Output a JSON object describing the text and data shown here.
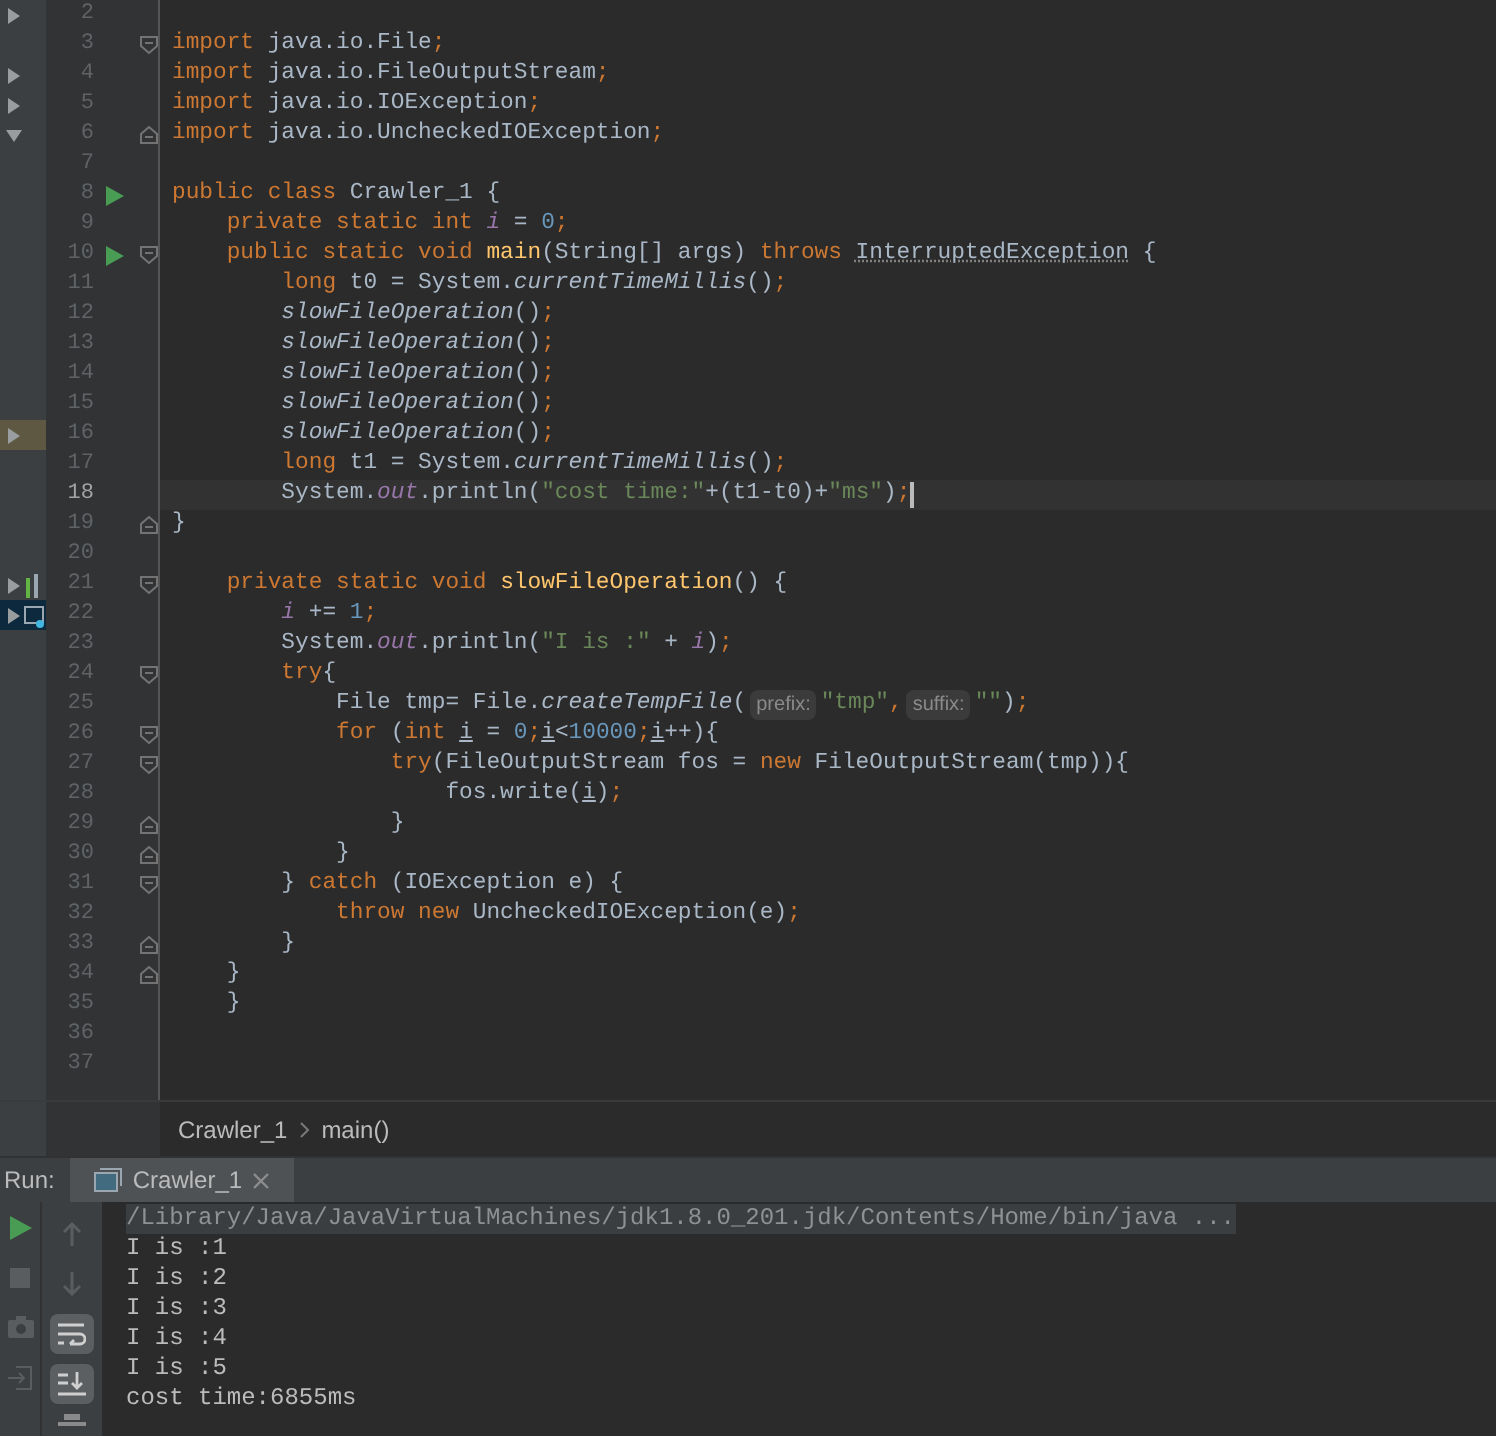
{
  "editor": {
    "lines": [
      {
        "number": "2",
        "fold_start": false,
        "fold_end": false,
        "run": false,
        "current": false,
        "tree": {
          "kind": "plain",
          "expanded": false,
          "highlighted": false,
          "selected": false
        }
      },
      {
        "number": "3",
        "fold_start": true,
        "fold_end": false,
        "run": false,
        "current": false,
        "tokens": [
          {
            "kind": "kw",
            "text": "import"
          },
          {
            "kind": "plain",
            "text": " java.io.File"
          },
          {
            "kind": "kw",
            "text": ";"
          }
        ]
      },
      {
        "number": "4",
        "fold_start": false,
        "fold_end": false,
        "run": false,
        "current": false,
        "tree": {
          "kind": "plain",
          "expanded": false,
          "highlighted": false,
          "selected": false
        },
        "tokens": [
          {
            "kind": "kw",
            "text": "import"
          },
          {
            "kind": "plain",
            "text": " java.io.FileOutputStream"
          },
          {
            "kind": "kw",
            "text": ";"
          }
        ]
      },
      {
        "number": "5",
        "fold_start": false,
        "fold_end": false,
        "run": false,
        "current": false,
        "tree": {
          "kind": "plain",
          "expanded": false,
          "highlighted": false,
          "selected": false
        },
        "tokens": [
          {
            "kind": "kw",
            "text": "import"
          },
          {
            "kind": "plain",
            "text": " java.io.IOException"
          },
          {
            "kind": "kw",
            "text": ";"
          }
        ]
      },
      {
        "number": "6",
        "fold_start": false,
        "fold_end": true,
        "run": false,
        "current": false,
        "tree": {
          "kind": "plain",
          "expanded": true,
          "highlighted": false,
          "selected": false
        },
        "tokens": [
          {
            "kind": "kw",
            "text": "import"
          },
          {
            "kind": "plain",
            "text": " java.io.UncheckedIOException"
          },
          {
            "kind": "kw",
            "text": ";"
          }
        ]
      },
      {
        "number": "7",
        "fold_start": false,
        "fold_end": false,
        "run": false,
        "current": false
      },
      {
        "number": "8",
        "fold_start": false,
        "fold_end": false,
        "run": true,
        "current": false,
        "tokens": [
          {
            "kind": "kw",
            "text": "public class "
          },
          {
            "kind": "plain",
            "text": "Crawler_1 {"
          }
        ]
      },
      {
        "number": "9",
        "fold_start": false,
        "fold_end": false,
        "run": false,
        "current": false,
        "tokens": [
          {
            "kind": "kw",
            "text": "    private static int "
          },
          {
            "kind": "field",
            "text": "i"
          },
          {
            "kind": "plain",
            "text": " = "
          },
          {
            "kind": "num",
            "text": "0"
          },
          {
            "kind": "kw",
            "text": ";"
          }
        ]
      },
      {
        "number": "10",
        "fold_start": true,
        "fold_end": false,
        "run": true,
        "current": false,
        "tokens": [
          {
            "kind": "kw",
            "text": "    public static void "
          },
          {
            "kind": "decl",
            "text": "main"
          },
          {
            "kind": "plain",
            "text": "(String[] args) "
          },
          {
            "kind": "kw",
            "text": "throws "
          },
          {
            "kind": "warn",
            "text": "InterruptedException"
          },
          {
            "kind": "plain",
            "text": " {"
          }
        ]
      },
      {
        "number": "11",
        "fold_start": false,
        "fold_end": false,
        "run": false,
        "current": false,
        "tokens": [
          {
            "kind": "kw",
            "text": "        long "
          },
          {
            "kind": "plain",
            "text": "t0 = System."
          },
          {
            "kind": "static",
            "text": "currentTimeMillis"
          },
          {
            "kind": "plain",
            "text": "()"
          },
          {
            "kind": "kw",
            "text": ";"
          }
        ]
      },
      {
        "number": "12",
        "fold_start": false,
        "fold_end": false,
        "run": false,
        "current": false,
        "tokens": [
          {
            "kind": "static",
            "text": "        slowFileOperation"
          },
          {
            "kind": "plain",
            "text": "()"
          },
          {
            "kind": "kw",
            "text": ";"
          }
        ]
      },
      {
        "number": "13",
        "fold_start": false,
        "fold_end": false,
        "run": false,
        "current": false,
        "tokens": [
          {
            "kind": "static",
            "text": "        slowFileOperation"
          },
          {
            "kind": "plain",
            "text": "()"
          },
          {
            "kind": "kw",
            "text": ";"
          }
        ]
      },
      {
        "number": "14",
        "fold_start": false,
        "fold_end": false,
        "run": false,
        "current": false,
        "tokens": [
          {
            "kind": "static",
            "text": "        slowFileOperation"
          },
          {
            "kind": "plain",
            "text": "()"
          },
          {
            "kind": "kw",
            "text": ";"
          }
        ]
      },
      {
        "number": "15",
        "fold_start": false,
        "fold_end": false,
        "run": false,
        "current": false,
        "tokens": [
          {
            "kind": "static",
            "text": "        slowFileOperation"
          },
          {
            "kind": "plain",
            "text": "()"
          },
          {
            "kind": "kw",
            "text": ";"
          }
        ]
      },
      {
        "number": "16",
        "fold_start": false,
        "fold_end": false,
        "run": false,
        "current": false,
        "tree": {
          "kind": "plain",
          "expanded": false,
          "highlighted": true,
          "selected": false
        },
        "tokens": [
          {
            "kind": "static",
            "text": "        slowFileOperation"
          },
          {
            "kind": "plain",
            "text": "()"
          },
          {
            "kind": "kw",
            "text": ";"
          }
        ]
      },
      {
        "number": "17",
        "fold_start": false,
        "fold_end": false,
        "run": false,
        "current": false,
        "tokens": [
          {
            "kind": "kw",
            "text": "        long "
          },
          {
            "kind": "plain",
            "text": "t1 = System."
          },
          {
            "kind": "static",
            "text": "currentTimeMillis"
          },
          {
            "kind": "plain",
            "text": "()"
          },
          {
            "kind": "kw",
            "text": ";"
          }
        ]
      },
      {
        "number": "18",
        "fold_start": false,
        "fold_end": false,
        "run": false,
        "current": true,
        "tokens": [
          {
            "kind": "plain",
            "text": "        System."
          },
          {
            "kind": "sfield",
            "text": "out"
          },
          {
            "kind": "plain",
            "text": ".println("
          },
          {
            "kind": "str",
            "text": "\"cost time:\""
          },
          {
            "kind": "plain",
            "text": "+(t1-t0)+"
          },
          {
            "kind": "str",
            "text": "\"ms\""
          },
          {
            "kind": "plain",
            "text": ")"
          },
          {
            "kind": "kw",
            "text": ";"
          }
        ]
      },
      {
        "number": "19",
        "fold_start": false,
        "fold_end": true,
        "run": false,
        "current": false,
        "tokens": [
          {
            "kind": "plain",
            "text": "}"
          }
        ]
      },
      {
        "number": "20",
        "fold_start": false,
        "fold_end": false,
        "run": false,
        "current": false
      },
      {
        "number": "21",
        "fold_start": true,
        "fold_end": false,
        "run": false,
        "current": false,
        "tree": {
          "kind": "chart",
          "expanded": false,
          "highlighted": false,
          "selected": false
        },
        "tokens": [
          {
            "kind": "kw",
            "text": "    private static void "
          },
          {
            "kind": "decl",
            "text": "slowFileOperation"
          },
          {
            "kind": "plain",
            "text": "() {"
          }
        ]
      },
      {
        "number": "22",
        "fold_start": false,
        "fold_end": false,
        "run": false,
        "current": false,
        "tree": {
          "kind": "console",
          "expanded": false,
          "highlighted": false,
          "selected": true
        },
        "tokens": [
          {
            "kind": "field",
            "text": "        i"
          },
          {
            "kind": "plain",
            "text": " += "
          },
          {
            "kind": "num",
            "text": "1"
          },
          {
            "kind": "kw",
            "text": ";"
          }
        ]
      },
      {
        "number": "23",
        "fold_start": false,
        "fold_end": false,
        "run": false,
        "current": false,
        "tokens": [
          {
            "kind": "plain",
            "text": "        System."
          },
          {
            "kind": "sfield",
            "text": "out"
          },
          {
            "kind": "plain",
            "text": ".println("
          },
          {
            "kind": "str",
            "text": "\"I is :\""
          },
          {
            "kind": "plain",
            "text": " + "
          },
          {
            "kind": "field",
            "text": "i"
          },
          {
            "kind": "plain",
            "text": ")"
          },
          {
            "kind": "kw",
            "text": ";"
          }
        ]
      },
      {
        "number": "24",
        "fold_start": true,
        "fold_end": false,
        "run": false,
        "current": false,
        "tokens": [
          {
            "kind": "kw",
            "text": "        try"
          },
          {
            "kind": "plain",
            "text": "{"
          }
        ]
      },
      {
        "number": "25",
        "fold_start": false,
        "fold_end": false,
        "run": false,
        "current": false,
        "tokens": [
          {
            "kind": "plain",
            "text": "            File tmp= File."
          },
          {
            "kind": "static",
            "text": "createTempFile"
          },
          {
            "kind": "plain",
            "text": "("
          },
          {
            "kind": "hint",
            "text": "prefix:"
          },
          {
            "kind": "str",
            "text": "\"tmp\""
          },
          {
            "kind": "kw",
            "text": ","
          },
          {
            "kind": "hint",
            "text": "suffix:"
          },
          {
            "kind": "str",
            "text": "\"\""
          },
          {
            "kind": "plain",
            "text": ")"
          },
          {
            "kind": "kw",
            "text": ";"
          }
        ]
      },
      {
        "number": "26",
        "fold_start": true,
        "fold_end": false,
        "run": false,
        "current": false,
        "tokens": [
          {
            "kind": "kw",
            "text": "            for "
          },
          {
            "kind": "plain",
            "text": "("
          },
          {
            "kind": "kw",
            "text": "int "
          },
          {
            "kind": "local",
            "text": "i"
          },
          {
            "kind": "plain",
            "text": " = "
          },
          {
            "kind": "num",
            "text": "0"
          },
          {
            "kind": "kw",
            "text": ";"
          },
          {
            "kind": "local",
            "text": "i"
          },
          {
            "kind": "plain",
            "text": "<"
          },
          {
            "kind": "num",
            "text": "10000"
          },
          {
            "kind": "kw",
            "text": ";"
          },
          {
            "kind": "local",
            "text": "i"
          },
          {
            "kind": "plain",
            "text": "++){"
          }
        ]
      },
      {
        "number": "27",
        "fold_start": true,
        "fold_end": false,
        "run": false,
        "current": false,
        "tokens": [
          {
            "kind": "kw",
            "text": "                try"
          },
          {
            "kind": "plain",
            "text": "(FileOutputStream fos = "
          },
          {
            "kind": "kw",
            "text": "new "
          },
          {
            "kind": "plain",
            "text": "FileOutputStream(tmp)){"
          }
        ]
      },
      {
        "number": "28",
        "fold_start": false,
        "fold_end": false,
        "run": false,
        "current": false,
        "tokens": [
          {
            "kind": "plain",
            "text": "                    fos.write("
          },
          {
            "kind": "local",
            "text": "i"
          },
          {
            "kind": "plain",
            "text": ")"
          },
          {
            "kind": "kw",
            "text": ";"
          }
        ]
      },
      {
        "number": "29",
        "fold_start": false,
        "fold_end": true,
        "run": false,
        "current": false,
        "tokens": [
          {
            "kind": "plain",
            "text": "                }"
          }
        ]
      },
      {
        "number": "30",
        "fold_start": false,
        "fold_end": true,
        "run": false,
        "current": false,
        "tokens": [
          {
            "kind": "plain",
            "text": "            }"
          }
        ]
      },
      {
        "number": "31",
        "fold_start": true,
        "fold_end": false,
        "run": false,
        "current": false,
        "tokens": [
          {
            "kind": "plain",
            "text": "        } "
          },
          {
            "kind": "kw",
            "text": "catch "
          },
          {
            "kind": "plain",
            "text": "(IOException e) {"
          }
        ]
      },
      {
        "number": "32",
        "fold_start": false,
        "fold_end": false,
        "run": false,
        "current": false,
        "tokens": [
          {
            "kind": "kw",
            "text": "            throw new "
          },
          {
            "kind": "plain",
            "text": "UncheckedIOException(e)"
          },
          {
            "kind": "kw",
            "text": ";"
          }
        ]
      },
      {
        "number": "33",
        "fold_start": false,
        "fold_end": true,
        "run": false,
        "current": false,
        "tokens": [
          {
            "kind": "plain",
            "text": "        }"
          }
        ]
      },
      {
        "number": "34",
        "fold_start": false,
        "fold_end": true,
        "run": false,
        "current": false,
        "tokens": [
          {
            "kind": "plain",
            "text": "    }"
          }
        ]
      },
      {
        "number": "35",
        "fold_start": false,
        "fold_end": false,
        "run": false,
        "current": false,
        "tokens": [
          {
            "kind": "plain",
            "text": "    }"
          }
        ]
      },
      {
        "number": "36",
        "fold_start": false,
        "fold_end": false,
        "run": false,
        "current": false
      },
      {
        "number": "37",
        "fold_start": false,
        "fold_end": false,
        "run": false,
        "current": false
      }
    ]
  },
  "breadcrumb": [
    "Crawler_1",
    "main()"
  ],
  "run_panel": {
    "label": "Run:",
    "tab": {
      "title": "Crawler_1",
      "selected": true
    },
    "tools": [
      {
        "kind": "up",
        "on": false
      },
      {
        "kind": "down",
        "on": false
      },
      {
        "kind": "wrap",
        "on": true
      },
      {
        "kind": "scroll-end",
        "on": true
      },
      {
        "kind": "print",
        "on": false
      }
    ],
    "console": [
      {
        "kind": "command",
        "text": "/Library/Java/JavaVirtualMachines/jdk1.8.0_201.jdk/Contents/Home/bin/java ..."
      },
      {
        "kind": "output",
        "text": "I is :1"
      },
      {
        "kind": "output",
        "text": "I is :2"
      },
      {
        "kind": "output",
        "text": "I is :3"
      },
      {
        "kind": "output",
        "text": "I is :4"
      },
      {
        "kind": "output",
        "text": "I is :5"
      },
      {
        "kind": "output",
        "text": "cost time:6855ms"
      }
    ]
  }
}
